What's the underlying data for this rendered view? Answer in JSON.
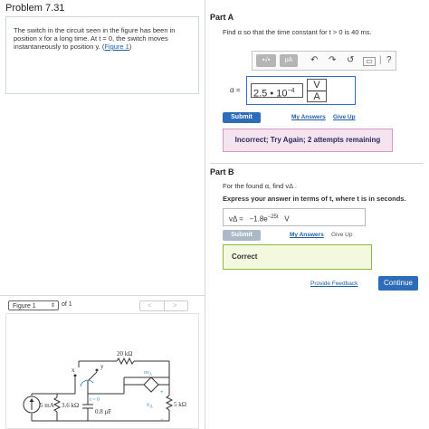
{
  "problem": {
    "title": "Problem 7.31",
    "description_pre": "The switch in the circuit seen in the figure has been in position x for a long time. At t = 0, the switch moves instantaneously to position y. (",
    "figure_link": "Figure 1",
    "description_post": ")"
  },
  "part_a": {
    "heading": "Part A",
    "question": "Find α so that the time constant for t > 0 is 40 ms.",
    "toolbar": {
      "templates_label": "▪√▪",
      "mu_label": "μA",
      "undo_icon": "undo-icon",
      "redo_icon": "redo-icon",
      "reset_icon": "reset-icon",
      "keyboard_icon": "keyboard-icon",
      "help_label": "?"
    },
    "answer_label": "α =",
    "answer_value": "2.5 • 10",
    "answer_exponent": "−4",
    "answer_unit_num": "V",
    "answer_unit_den": "A",
    "submit_label": "Submit",
    "my_answers_label": "My Answers",
    "give_up_label": "Give Up",
    "feedback": "Incorrect; Try Again; 2 attempts remaining"
  },
  "part_b": {
    "heading": "Part B",
    "question": "For the found α, find vΔ .",
    "instruction": "Express your answer in terms of t, where t is in seconds.",
    "answer_label": "vΔ =",
    "answer_value": "−1.8e",
    "answer_exponent": "−25t",
    "answer_unit": "V",
    "submit_label": "Submit",
    "my_answers_label": "My Answers",
    "give_up_label": "Give Up",
    "feedback": "Correct"
  },
  "footer": {
    "provide_feedback_label": "Provide Feedback",
    "continue_label": "Continue"
  },
  "figure_nav": {
    "selected": "Figure 1",
    "of_label": "of 1",
    "prev_label": "<",
    "next_label": ">"
  },
  "circuit": {
    "resistor_top": "20 kΩ",
    "dependent_source": "αv",
    "dependent_source_sub": "Δ",
    "switch_x": "x",
    "switch_y": "y",
    "current_source": "5 mA",
    "resistor_left": "3.6 kΩ",
    "switch_time": "t = 0",
    "capacitor": "0.8 μF",
    "v_delta": "v",
    "v_delta_sub": "Δ",
    "resistor_right": "5 kΩ",
    "plus": "+",
    "minus": "−",
    "colors": {
      "accent": "#3c8fd0",
      "wire": "#333333"
    }
  },
  "colors": {
    "primary_button": "#2d6cb8",
    "incorrect_bg": "#f6e3f0",
    "correct_border": "#8dbb3f"
  }
}
